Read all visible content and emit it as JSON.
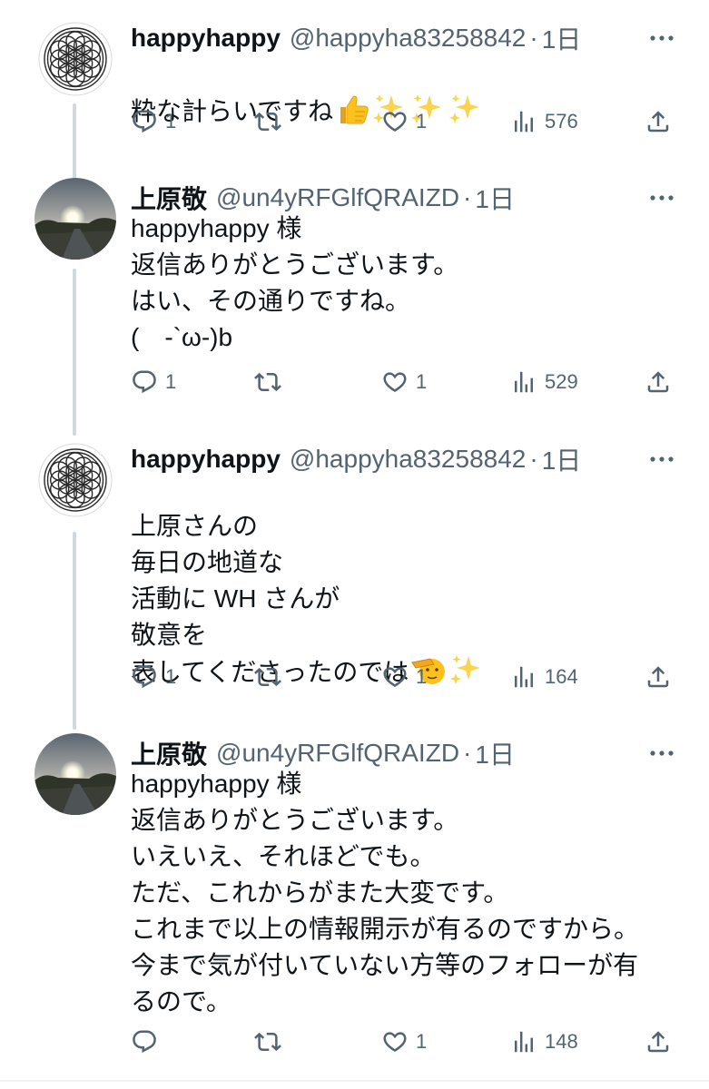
{
  "tweets": [
    {
      "name": "happyhappy",
      "handle": "@happyha83258842",
      "separator": "·",
      "time": "1日",
      "avatar": "flower-of-life-avatar",
      "text": "粋な計らいですね",
      "emoji": [
        "thumbs-up",
        "sparkles",
        "sparkles",
        "sparkles"
      ],
      "replies": "1",
      "retweets": "",
      "likes": "1",
      "views": "576"
    },
    {
      "name": "上原敬",
      "handle": "@un4yRFGlfQRAIZD",
      "separator": "·",
      "time": "1日",
      "avatar": "sunset-road-avatar",
      "text": "happyhappy 様\n返信ありがとうございます。\nはい、その通りですね。\n(　-`ω-)b",
      "emoji": [],
      "replies": "1",
      "retweets": "",
      "likes": "1",
      "views": "529"
    },
    {
      "name": "happyhappy",
      "handle": "@happyha83258842",
      "separator": "·",
      "time": "1日",
      "avatar": "flower-of-life-avatar",
      "text": "上原さんの\n毎日の地道な\n活動に WH さんが\n敬意を\n表してくださったのでは",
      "emoji": [
        "saluting-face",
        "sparkles"
      ],
      "replies": "1",
      "retweets": "",
      "likes": "1",
      "views": "164"
    },
    {
      "name": "上原敬",
      "handle": "@un4yRFGlfQRAIZD",
      "separator": "·",
      "time": "1日",
      "avatar": "sunset-road-avatar",
      "text": "happyhappy 様\n返信ありがとうございます。\nいえいえ、それほどでも。\nただ、これからがまた大変です。\nこれまで以上の情報開示が有るのですから。\n今まで気が付いていない方等のフォローが有\nるので。",
      "emoji": [],
      "replies": "",
      "retweets": "",
      "likes": "1",
      "views": "148"
    }
  ],
  "icons": {
    "reply": "reply-icon",
    "retweet": "retweet-icon",
    "like": "heart-icon",
    "views": "views-chart-icon",
    "share": "share-icon",
    "more": "more-dots-icon"
  },
  "colors": {
    "text_primary": "#0f1419",
    "text_secondary": "#536471",
    "thread_line": "#cfd9de"
  }
}
